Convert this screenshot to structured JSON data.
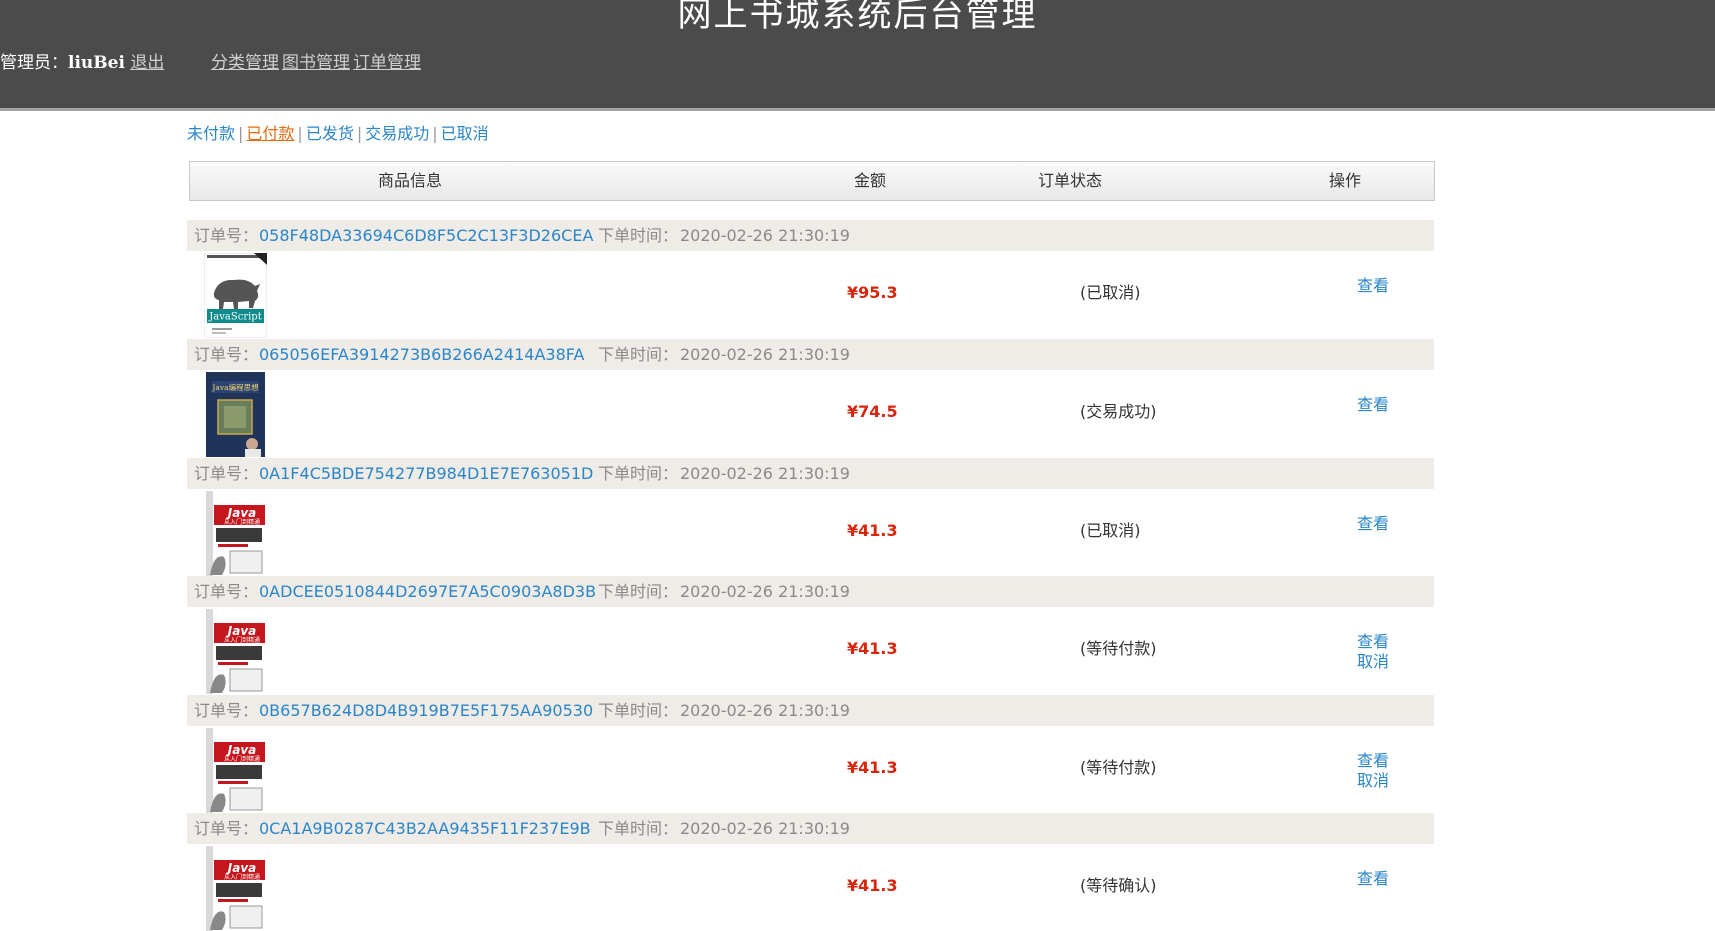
{
  "header": {
    "title": "网上书城系统后台管理",
    "admin_label": "管理员：",
    "admin_name": "liuBei",
    "logout": "退出",
    "nav": [
      "分类管理",
      "图书管理",
      "订单管理"
    ]
  },
  "filters": {
    "items": [
      "未付款",
      "已付款",
      "已发货",
      "交易成功",
      "已取消"
    ],
    "active": "已付款"
  },
  "table": {
    "columns": [
      "商品信息",
      "金额",
      "订单状态",
      "操作"
    ]
  },
  "labels": {
    "order_no": "订单号：",
    "order_time": "下单时间："
  },
  "orders": [
    {
      "id": "058F48DA33694C6D8F5C2C13F3D26CEA",
      "time": "2020-02-26 21:30:19",
      "price": "¥95.3",
      "status": "(已取消)",
      "actions": [
        "查看"
      ],
      "cover": "javascript-rhino"
    },
    {
      "id": "065056EFA3914273B6B266A2414A38FA",
      "time": "2020-02-26 21:30:19",
      "price": "¥74.5",
      "status": "(交易成功)",
      "actions": [
        "查看"
      ],
      "cover": "java-thinking"
    },
    {
      "id": "0A1F4C5BDE754277B984D1E7E763051D",
      "time": "2020-02-26 21:30:19",
      "price": "¥41.3",
      "status": "(已取消)",
      "actions": [
        "查看"
      ],
      "cover": "java-beginner"
    },
    {
      "id": "0ADCEE0510844D2697E7A5C0903A8D3B",
      "time": "2020-02-26 21:30:19",
      "price": "¥41.3",
      "status": "(等待付款)",
      "actions": [
        "查看",
        "取消"
      ],
      "cover": "java-beginner"
    },
    {
      "id": "0B657B624D8D4B919B7E5F175AA90530",
      "time": "2020-02-26 21:30:19",
      "price": "¥41.3",
      "status": "(等待付款)",
      "actions": [
        "查看",
        "取消"
      ],
      "cover": "java-beginner"
    },
    {
      "id": "0CA1A9B0287C43B2AA9435F11F237E9B",
      "time": "2020-02-26 21:30:19",
      "price": "¥41.3",
      "status": "(等待确认)",
      "actions": [
        "查看"
      ],
      "cover": "java-beginner"
    }
  ],
  "covers": {
    "javascript-rhino": {
      "text": "JavaScript"
    },
    "java-thinking": {
      "text": "Java编程思想"
    },
    "java-beginner": {
      "text": "Java",
      "sub": "从入门到精通"
    }
  },
  "colors": {
    "header_bg": "#4b4b4b",
    "link": "#2a86c8",
    "active_filter": "#e66a10",
    "price": "#d8250c",
    "order_head_bg": "#efebe7"
  }
}
